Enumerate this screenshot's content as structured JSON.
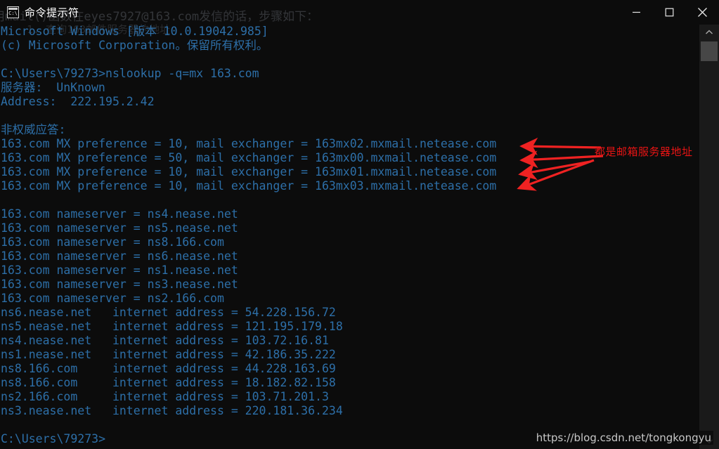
{
  "window": {
    "title": "命令提示符",
    "icon": "cmd-icon",
    "icon_text": "C:\\",
    "controls": [
      {
        "name": "minimize",
        "glyph": "minimize-icon"
      },
      {
        "name": "maximize",
        "glyph": "maximize-icon"
      },
      {
        "name": "close",
        "glyph": "close-icon"
      }
    ]
  },
  "ghost_background": {
    "line1": "用mail()函数在eyes7927@163.com发信的话，步骤如下：",
    "line2": "1. 查询163邮件服务器的地址"
  },
  "console": {
    "text_color": "#2d6fa8",
    "background_color": "#0c0c0c",
    "lines": [
      "Microsoft Windows [版本 10.0.19042.985]",
      "(c) Microsoft Corporation。保留所有权利。",
      "",
      "C:\\Users\\79273>nslookup -q=mx 163.com",
      "服务器:  UnKnown",
      "Address:  222.195.2.42",
      "",
      "非权威应答:",
      "163.com MX preference = 10, mail exchanger = 163mx02.mxmail.netease.com",
      "163.com MX preference = 50, mail exchanger = 163mx00.mxmail.netease.com",
      "163.com MX preference = 10, mail exchanger = 163mx01.mxmail.netease.com",
      "163.com MX preference = 10, mail exchanger = 163mx03.mxmail.netease.com",
      "",
      "163.com nameserver = ns4.nease.net",
      "163.com nameserver = ns5.nease.net",
      "163.com nameserver = ns8.166.com",
      "163.com nameserver = ns6.nease.net",
      "163.com nameserver = ns1.nease.net",
      "163.com nameserver = ns3.nease.net",
      "163.com nameserver = ns2.166.com",
      "ns6.nease.net   internet address = 54.228.156.72",
      "ns5.nease.net   internet address = 121.195.179.18",
      "ns4.nease.net   internet address = 103.72.16.81",
      "ns1.nease.net   internet address = 42.186.35.222",
      "ns8.166.com     internet address = 44.228.163.69",
      "ns8.166.com     internet address = 18.182.82.158",
      "ns2.166.com     internet address = 103.71.201.3",
      "ns3.nease.net   internet address = 220.181.36.234",
      "",
      "C:\\Users\\79273>"
    ],
    "command": "nslookup -q=mx 163.com",
    "prompt": "C:\\Users\\79273>",
    "dns_server_name": "UnKnown",
    "dns_server_address": "222.195.2.42",
    "os_version": "10.0.19042.985",
    "mx_records": [
      {
        "domain": "163.com",
        "preference": "10",
        "exchanger": "163mx02.mxmail.netease.com"
      },
      {
        "domain": "163.com",
        "preference": "50",
        "exchanger": "163mx00.mxmail.netease.com"
      },
      {
        "domain": "163.com",
        "preference": "10",
        "exchanger": "163mx01.mxmail.netease.com"
      },
      {
        "domain": "163.com",
        "preference": "10",
        "exchanger": "163mx03.mxmail.netease.com"
      }
    ],
    "nameservers": [
      "ns4.nease.net",
      "ns5.nease.net",
      "ns8.166.com",
      "ns6.nease.net",
      "ns1.nease.net",
      "ns3.nease.net",
      "ns2.166.com"
    ],
    "addresses": [
      {
        "host": "ns6.nease.net",
        "ip": "54.228.156.72"
      },
      {
        "host": "ns5.nease.net",
        "ip": "121.195.179.18"
      },
      {
        "host": "ns4.nease.net",
        "ip": "103.72.16.81"
      },
      {
        "host": "ns1.nease.net",
        "ip": "42.186.35.222"
      },
      {
        "host": "ns8.166.com",
        "ip": "44.228.163.69"
      },
      {
        "host": "ns8.166.com",
        "ip": "18.182.82.158"
      },
      {
        "host": "ns2.166.com",
        "ip": "103.71.201.3"
      },
      {
        "host": "ns3.nease.net",
        "ip": "220.181.36.234"
      }
    ]
  },
  "annotation": {
    "label": "都是邮箱服务器地址",
    "color": "#e81414",
    "arrow_count": 4
  },
  "watermark": {
    "text": "https://blog.csdn.net/tongkongyu"
  },
  "scrollbar": {
    "up_arrow": "chevron-up-icon",
    "down_arrow": "chevron-down-icon"
  }
}
